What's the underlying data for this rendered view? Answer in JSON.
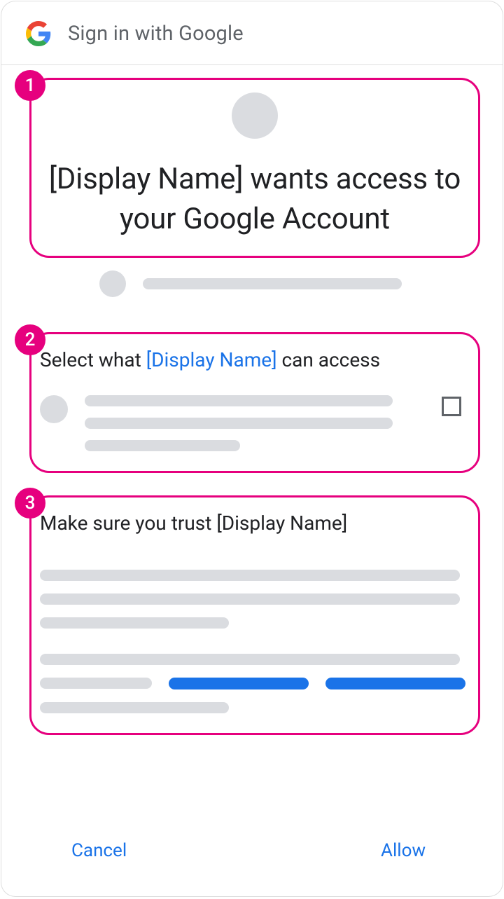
{
  "header": {
    "title": "Sign in with Google"
  },
  "callouts": {
    "one": "1",
    "two": "2",
    "three": "3"
  },
  "section1": {
    "heading": "[Display Name] wants access to your Google Account"
  },
  "section2": {
    "prefix": "Select what ",
    "link": "[Display Name]",
    "suffix": " can access"
  },
  "section3": {
    "heading": "Make sure you trust [Display Name]"
  },
  "actions": {
    "cancel": "Cancel",
    "allow": "Allow"
  }
}
